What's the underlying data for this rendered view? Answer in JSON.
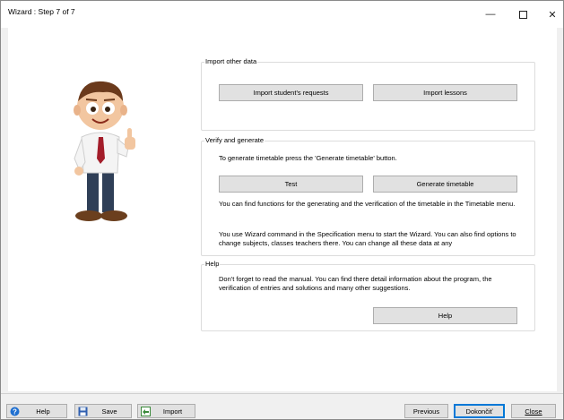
{
  "window": {
    "title": "Wizard : Step 7 of 7",
    "minimize_glyph": "—",
    "close_glyph": "✕"
  },
  "import_group": {
    "title": "Import other data",
    "import_requests_label": "Import student's requests",
    "import_lessons_label": "Import lessons"
  },
  "verify_group": {
    "title": "Verify and generate",
    "intro_text": "To generate timetable press the 'Generate timetable' button.",
    "test_label": "Test",
    "generate_label": "Generate timetable",
    "functions_text": "You can find functions for the generating and the verification of the timetable in the Timetable menu.",
    "wizard_text": "You use Wizard command in the Specification menu to start the Wizard. You can also find options to change subjects, classes teachers there. You can change all these data at any"
  },
  "help_group": {
    "title": "Help",
    "manual_text": "Don't forget to read the manual. You can find there detail information about the program, the verification of entries and solutions and many other suggestions.",
    "help_label": "Help"
  },
  "footer": {
    "help_label": "Help",
    "save_label": "Save",
    "import_label": "Import",
    "previous_label": "Previous",
    "finish_label": "Dokončiť",
    "close_label": "Close"
  },
  "colors": {
    "accent": "#0078d7",
    "button_face": "#e1e1e1"
  }
}
